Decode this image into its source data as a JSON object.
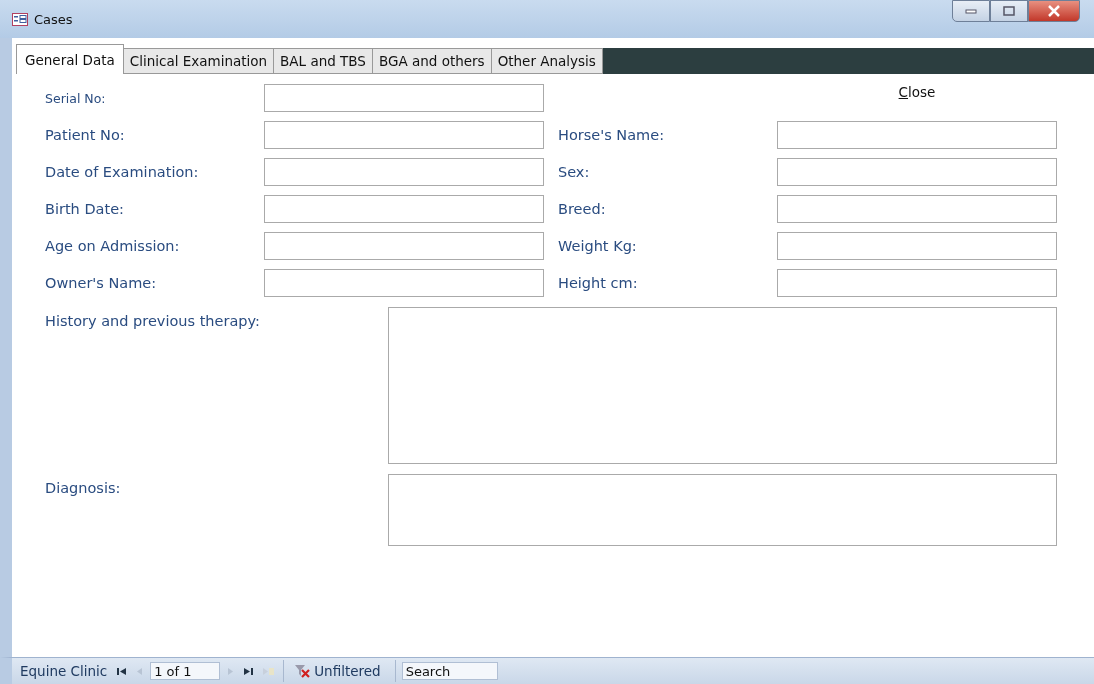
{
  "window": {
    "title": "Cases"
  },
  "tabs": [
    {
      "label": "General Data",
      "selected": true
    },
    {
      "label": "Clinical Examination",
      "selected": false
    },
    {
      "label": "BAL and TBS",
      "selected": false
    },
    {
      "label": "BGA and others",
      "selected": false
    },
    {
      "label": "Other Analysis",
      "selected": false
    }
  ],
  "serial_field": {
    "label": "Serial No:"
  },
  "close_button": {
    "label": "Close"
  },
  "left_fields": [
    {
      "label": "Patient No:"
    },
    {
      "label": "Date of Examination:"
    },
    {
      "label": "Birth Date:"
    },
    {
      "label": "Age on Admission:"
    },
    {
      "label": "Owner's Name:"
    }
  ],
  "right_fields": [
    {
      "label": "Horse's Name:"
    },
    {
      "label": "Sex:"
    },
    {
      "label": "Breed:"
    },
    {
      "label": "Weight Kg:"
    },
    {
      "label": "Height cm:"
    }
  ],
  "memo_fields": [
    {
      "label": "History and previous therapy:",
      "kind": "tall"
    },
    {
      "label": "Diagnosis:",
      "kind": "short"
    }
  ],
  "status_bar": {
    "form_name": "Equine Clinic",
    "record": "1 of 1",
    "filter": "Unfiltered",
    "search": "Search"
  }
}
